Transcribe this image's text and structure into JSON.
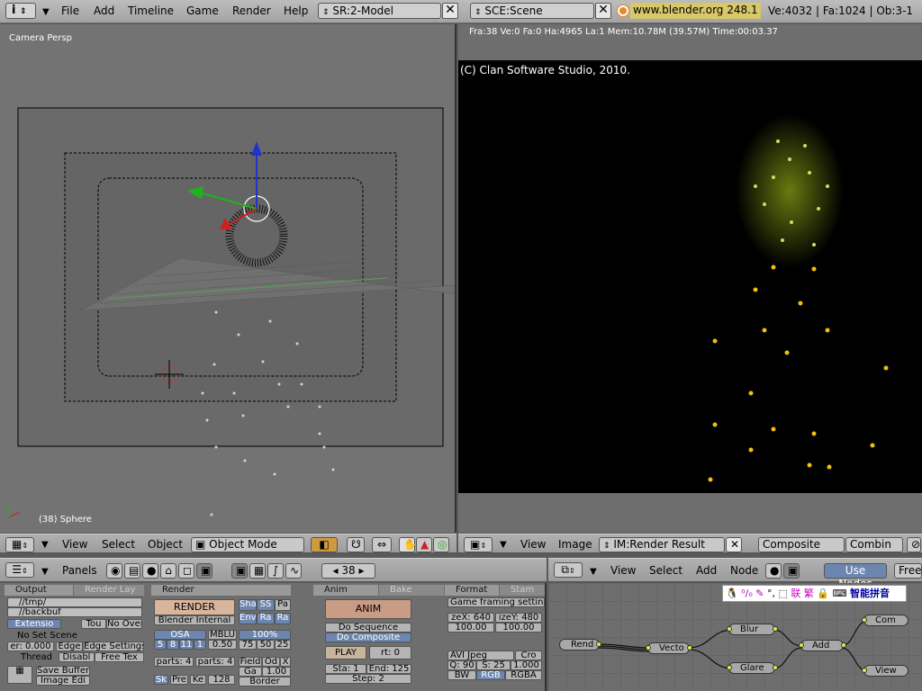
{
  "topbar": {
    "menus": [
      "File",
      "Add",
      "Timeline",
      "Game",
      "Render",
      "Help"
    ],
    "screen": "SR:2-Model",
    "scene": "SCE:Scene",
    "url": "www.blender.org 248.1",
    "stats": "Ve:4032 | Fa:1024 | Ob:3-1"
  },
  "view3d": {
    "label": "Camera Persp",
    "object_label": "(38) Sphere",
    "header": {
      "menus": [
        "View",
        "Select",
        "Object"
      ],
      "mode": "Object Mode"
    }
  },
  "render": {
    "info": "Fra:38  Ve:0 Fa:0 Ha:4965 La:1 Mem:10.78M (39.57M) Time:00:03.37",
    "copyright": "(C) Clan Software Studio, 2010.",
    "header": {
      "menus": [
        "View",
        "Image"
      ],
      "image": "IM:Render Result",
      "composite": "Composite",
      "combine": "Combin"
    }
  },
  "buttons": {
    "header": {
      "panels": "Panels",
      "frame": "38"
    },
    "output": {
      "tab": "Output",
      "tab2": "Render Lay",
      "path1": "//tmp/",
      "path2": "//backbuf",
      "extensions": "Extensio",
      "touch": "Tou",
      "no_overwrite": "No Over",
      "no_set_scene": "No Set Scene",
      "edge_er": "er: 0.000",
      "edge": "Edge",
      "edge_settings": "Edge Settings",
      "threads": "Thread",
      "disable": "Disabl",
      "free_tex": "Free Tex",
      "save_buffers": "Save Buffer",
      "image_editor": "Image Edi"
    },
    "render_panel": {
      "tab": "Render",
      "render": "RENDER",
      "engine": "Blender Internal",
      "sha": "Sha",
      "ss": "SS",
      "pa": "Pa",
      "env": "Env",
      "ra": "Ra",
      "ra2": "Ra",
      "osa": "OSA",
      "mblur": "MBLU",
      "pct": "100%",
      "osa_vals": [
        "5",
        "8",
        "11",
        "1"
      ],
      "mblur_val": "0.50",
      "pcts": [
        "75",
        "50",
        "25"
      ],
      "parts1": "parts: 4",
      "parts2": "parts: 4",
      "field": "Field",
      "odd": "Od",
      "x": "X",
      "gauss": "Ga",
      "gauss_val": "1.00",
      "border": "Border",
      "sky": "Sk",
      "premul": "Pre",
      "key": "Ke",
      "size": "128"
    },
    "anim": {
      "tab": "Anim",
      "tab2": "Bake",
      "anim": "ANIM",
      "do_sequence": "Do Sequence",
      "do_composite": "Do Composite",
      "play": "PLAY",
      "rt": "rt: 0",
      "sta": "Sta: 1",
      "end": "End: 125",
      "step": "Step: 2"
    },
    "format": {
      "tab": "Format",
      "tab2": "Stam",
      "game": "Game framing setting",
      "sizex": "zeX: 640",
      "sizey": "izeY: 480",
      "aspx": "100.00",
      "aspy": "100.00",
      "codec": "AVI Jpeg",
      "crop": "Cro",
      "quality": "Q: 90",
      "s": "S: 25",
      "val": "1.000",
      "bw": "BW",
      "rgb": "RGB",
      "rgba": "RGBA"
    }
  },
  "nodes": {
    "header": {
      "menus": [
        "View",
        "Select",
        "Add",
        "Node"
      ],
      "use_nodes": "Use Nodes",
      "free": "Free"
    },
    "ime": "智能拼音",
    "ime_icons": [
      "联",
      "繁"
    ],
    "node_names": {
      "render": "Rend",
      "vector": "Vecto",
      "blur": "Blur",
      "glare": "Glare",
      "add": "Add",
      "composite": "Com",
      "viewer": "View"
    }
  },
  "colors": {
    "accent": "#d8c86a",
    "panel": "#6e6e6e",
    "header": "#a8a8a8"
  }
}
